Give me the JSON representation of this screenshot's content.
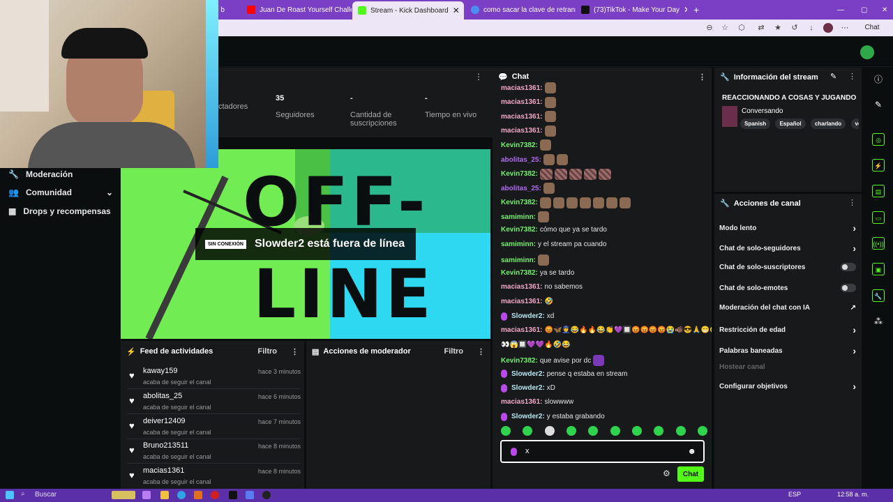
{
  "browser": {
    "tabs": [
      {
        "label": "p b",
        "active": false
      },
      {
        "label": "Juan De Roast Yourself Challenge",
        "active": false
      },
      {
        "label": "Stream - Kick Dashboard",
        "active": true
      },
      {
        "label": "como sacar la clave de retransmisi",
        "active": false
      },
      {
        "label": "(73)TikTok - Make Your Day",
        "active": false
      }
    ],
    "new_tab": "+",
    "window_controls": [
      "—",
      "▢",
      "✕"
    ],
    "copilot_label": "Chat"
  },
  "sidebar": {
    "items": [
      {
        "label": "Moderación",
        "icon": "wrench-icon"
      },
      {
        "label": "Comunidad",
        "icon": "people-icon"
      },
      {
        "label": "Drops y recompensas",
        "icon": "gift-icon"
      }
    ]
  },
  "stats": {
    "items": [
      {
        "value": "",
        "label": "ctadores"
      },
      {
        "value": "35",
        "label": "Seguidores"
      },
      {
        "value": "-",
        "label": "Cantidad de suscripciones"
      },
      {
        "value": "-",
        "label": "Tiempo en vivo"
      }
    ]
  },
  "offline": {
    "badge": "SIN CONEXIÓN",
    "message": "Slowder2 está fuera de línea",
    "art_text_top": "OFF-",
    "art_text_bottom": "LINE"
  },
  "activity": {
    "title": "Feed de actividades",
    "filter": "Filtro",
    "items": [
      {
        "user": "kaway159",
        "desc": "acaba de seguir el canal",
        "time": "hace 3 minutos"
      },
      {
        "user": "abolitas_25",
        "desc": "acaba de seguir el canal",
        "time": "hace 6 minutos"
      },
      {
        "user": "deiver12409",
        "desc": "acaba de seguir el canal",
        "time": "hace 7 minutos"
      },
      {
        "user": "Bruno213511",
        "desc": "acaba de seguir el canal",
        "time": "hace 8 minutos"
      },
      {
        "user": "macias1361",
        "desc": "acaba de seguir el canal",
        "time": "hace 8 minutos"
      }
    ]
  },
  "mod_actions": {
    "title": "Acciones de moderador",
    "filter": "Filtro"
  },
  "chat": {
    "title": "Chat",
    "messages": [
      {
        "user": "macias1361:",
        "text": "",
        "color": "#f4a9c6",
        "emotes": 1,
        "mic": false
      },
      {
        "user": "macias1361:",
        "text": "",
        "color": "#f4a9c6",
        "emotes": 1,
        "mic": false
      },
      {
        "user": "macias1361:",
        "text": "",
        "color": "#f4a9c6",
        "emotes": 1,
        "mic": false
      },
      {
        "user": "macias1361:",
        "text": "",
        "color": "#f4a9c6",
        "emotes": 1,
        "mic": false
      },
      {
        "user": "Kevin7382:",
        "text": "",
        "color": "#72f26a",
        "emotes": 1,
        "mic": false
      },
      {
        "user": "abolitas_25:",
        "text": "",
        "color": "#b06cf2",
        "emotes": 2,
        "mic": false
      },
      {
        "user": "Kevin7382:",
        "text": "",
        "color": "#72f26a",
        "emotes": 5,
        "mic": false
      },
      {
        "user": "abolitas_25:",
        "text": "",
        "color": "#b06cf2",
        "emotes": 1,
        "mic": false
      },
      {
        "user": "Kevin7382:",
        "text": "",
        "color": "#72f26a",
        "emotes": 7,
        "mic": false
      },
      {
        "user": "samiminn:",
        "text": "",
        "color": "#72f26a",
        "emotes": 1,
        "mic": false
      },
      {
        "user": "Kevin7382:",
        "text": "cómo que ya se tardo",
        "color": "#72f26a",
        "emotes": 0,
        "mic": false
      },
      {
        "user": "samiminn:",
        "text": "y el stream pa cuando",
        "color": "#72f26a",
        "emotes": 0,
        "mic": false
      },
      {
        "user": "samiminn:",
        "text": "",
        "color": "#72f26a",
        "emotes": 1,
        "mic": false
      },
      {
        "user": "Kevin7382:",
        "text": "ya se tardo",
        "color": "#72f26a",
        "emotes": 0,
        "mic": false
      },
      {
        "user": "macias1361:",
        "text": "no sabemos",
        "color": "#f4a9c6",
        "emotes": 0,
        "mic": false
      },
      {
        "user": "macias1361:",
        "text": "🤣",
        "color": "#f4a9c6",
        "emotes": 0,
        "mic": false
      },
      {
        "user": "Slowder2:",
        "text": "xd",
        "color": "#b8e8f4",
        "emotes": 0,
        "mic": true
      },
      {
        "user": "macias1361:",
        "text": "😡🦋👮😂🔥🔥😂👏💜🔲😡😡😡😡😭🐗😎🙏😁🤣",
        "color": "#f4a9c6",
        "emotes": 0,
        "mic": false
      },
      {
        "user": "",
        "text": "👀😱🔲💜💜🔥🤣😂",
        "color": "#f4a9c6",
        "emotes": 0,
        "mic": false
      },
      {
        "user": "Kevin7382:",
        "text": "que avise por dc",
        "color": "#72f26a",
        "emotes": 1,
        "mic": false
      },
      {
        "user": "Slowder2:",
        "text": "pense q estaba en stream",
        "color": "#b8e8f4",
        "emotes": 0,
        "mic": true
      },
      {
        "user": "Slowder2:",
        "text": "xD",
        "color": "#b8e8f4",
        "emotes": 0,
        "mic": true
      },
      {
        "user": "macias1361:",
        "text": "slowwww",
        "color": "#f4a9c6",
        "emotes": 0,
        "mic": false
      },
      {
        "user": "Slowder2:",
        "text": "y estaba grabando",
        "color": "#b8e8f4",
        "emotes": 0,
        "mic": true
      }
    ],
    "input_value": "x",
    "send_label": "Chat"
  },
  "stream_info": {
    "title": "Información del stream",
    "stream_title": "REACCIONANDO A COSAS Y JUGANDO",
    "category": "Conversando",
    "tags": [
      "Spanish",
      "Español",
      "charlando",
      "ve"
    ]
  },
  "channel_actions": {
    "title": "Acciones de canal",
    "items": [
      {
        "label": "Modo lento",
        "control": "chevron"
      },
      {
        "label": "Chat de solo-seguidores",
        "control": "chevron"
      },
      {
        "label": "Chat de solo-suscriptores",
        "control": "toggle"
      },
      {
        "label": "Chat de solo-emotes",
        "control": "toggle"
      },
      {
        "label": "Moderación del chat con IA",
        "control": "external"
      },
      {
        "label": "Restricción de edad",
        "control": "chevron"
      },
      {
        "label": "Palabras baneadas",
        "control": "chevron"
      },
      {
        "label": "Hostear canal",
        "control": "none"
      },
      {
        "label": "Configurar objetivos",
        "control": "chevron"
      }
    ]
  },
  "taskbar": {
    "search_placeholder": "Buscar",
    "lang": "ESP",
    "time": "12:58 a. m."
  },
  "colors": {
    "accent": "#53fc18",
    "browser": "#7a3fc4",
    "taskbar": "#5b2fa8"
  }
}
